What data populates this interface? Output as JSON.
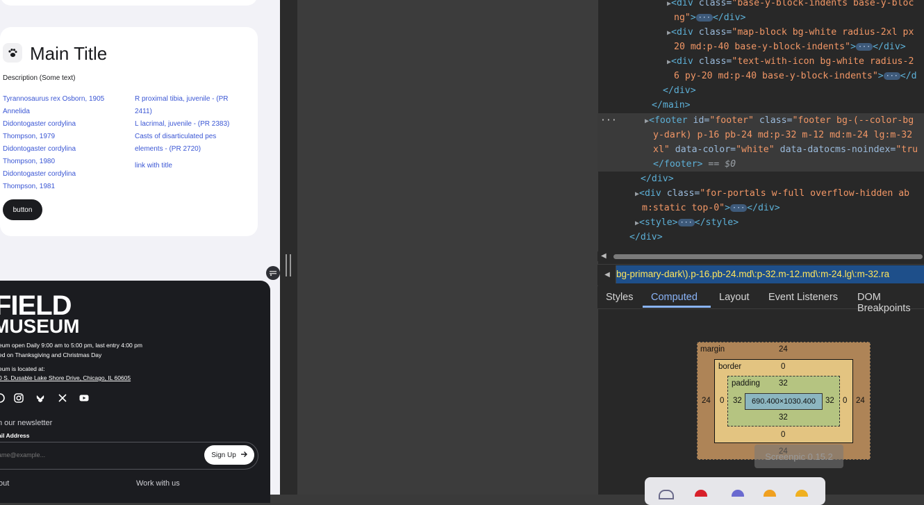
{
  "preview": {
    "title": "Main Title",
    "description": "Description (Some text)",
    "links_left": [
      "Tyrannosaurus rex Osborn, 1905",
      "Annelida",
      "Didontogaster cordylina",
      "Thompson, 1979",
      "Didontogaster cordylina",
      "Thompson, 1980",
      "Didontogaster cordylina",
      "Thompson, 1981"
    ],
    "links_right": [
      "R proximal tibia, juvenile - (PR",
      "2411)",
      "L lacrimal, juvenile - (PR 2383)",
      "Casts of disarticulated pes",
      "elements - (PR 2720)",
      "link with title"
    ],
    "button": "button",
    "footer": {
      "logo_line1": "FIELD",
      "logo_line2": "MUSEUM",
      "hours1": "eum open Daily 9:00 am to 5:00 pm, last entry 4:00 pm",
      "hours2": "ed on Thanksgiving and Christmas Day",
      "located": "eum is located at:",
      "address": "0 S. Dusable Lake Shore Drive, Chicago, IL 60605",
      "newsletter": "n our newsletter",
      "email_label": "ail Address",
      "email_placeholder": "ame@example...",
      "signup": "Sign Up",
      "about": "out",
      "work": "Work with us"
    }
  },
  "devtools": {
    "lines": {
      "l1_a": "<div",
      "l1_attr": " class=",
      "l1_val": "\"base-y-block-indents base-y-bloc",
      "l2_val": "ng\"",
      "l2_end": "</div>",
      "l3_a": "<div",
      "l3_attr": " class=",
      "l3_val": "\"map-block bg-white radius-2xl px",
      "l4_val": "20 md:p-40 base-y-block-indents\"",
      "l4_end": "</div>",
      "l5_a": "<div",
      "l5_attr": " class=",
      "l5_val": "\"text-with-icon bg-white radius-2",
      "l6_val": "6 py-20 md:p-40 base-y-block-indents\"",
      "l6_end": "</d",
      "l7": "</div>",
      "l8": "</main>",
      "l9_a": "<footer",
      "l9_id": " id=",
      "l9_idv": "\"footer\"",
      "l9_cls": " class=",
      "l9_clsv": "\"footer bg-(--color-bg",
      "l10_val": "y-dark) p-16 pb-24 md:p-32 m-12 md:m-24 lg:m-32",
      "l11_val": "xl\"",
      "l11_dc": " data-color=",
      "l11_dcv": "\"white\"",
      "l11_dn": " data-datocms-noindex=",
      "l11_dnv": "\"tru",
      "l12": "</footer>",
      "l12_eq": " == $0",
      "l13": "</div>",
      "l14_a": "<div",
      "l14_attr": " class=",
      "l14_val": "\"for-portals w-full overflow-hidden ab",
      "l15_val": "m:static top-0\"",
      "l15_end": "</div>",
      "l16_a": "<style>",
      "l16_end": "</style>",
      "l17": "</div>"
    },
    "breadcrumb": "bg-primary-dark\\).p-16.pb-24.md\\:p-32.m-12.md\\:m-24.lg\\:m-32.ra",
    "tabs": [
      "Styles",
      "Computed",
      "Layout",
      "Event Listeners",
      "DOM Breakpoints"
    ],
    "box_model": {
      "margin_label": "margin",
      "margin_top": "24",
      "margin_bottom": "24",
      "margin_left": "24",
      "margin_right": "24",
      "border_label": "border",
      "border_top": "0",
      "border_bottom": "0",
      "border_left": "0",
      "border_right": "0",
      "padding_label": "padding",
      "padding_top": "32",
      "padding_bottom": "32",
      "padding_left": "32",
      "padding_right": "32",
      "content": "690.400×1030.400"
    },
    "toast": "Screenpic 0.15.2"
  }
}
